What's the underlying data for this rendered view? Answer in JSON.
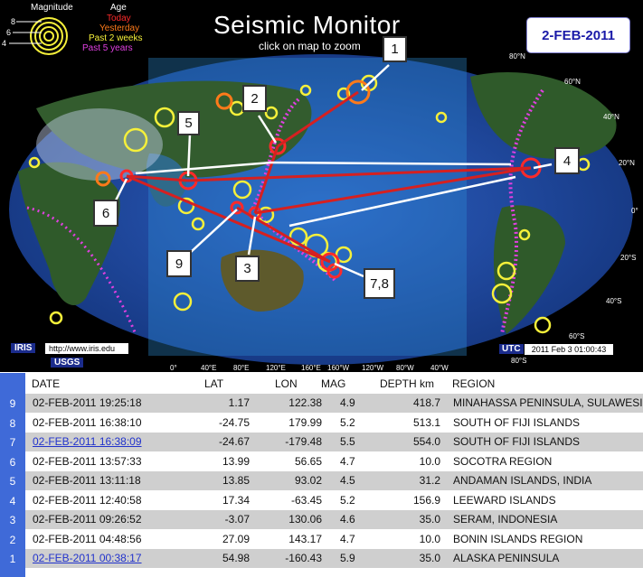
{
  "legend": {
    "magnitude_label": "Magnitude",
    "age_label": "Age",
    "mag_ticks": [
      "8",
      "6",
      "4"
    ],
    "age_items": [
      {
        "label": "Today",
        "color": "#ff2a2a"
      },
      {
        "label": "Yesterday",
        "color": "#ff7a1a"
      },
      {
        "label": "Past 2 weeks",
        "color": "#f5f03a"
      },
      {
        "label": "Past 5 years",
        "color": "#e040e0"
      }
    ]
  },
  "title": "Seismic Monitor",
  "subtitle": "click on map to zoom",
  "date_box": "2-FEB-2011",
  "callouts": [
    "1",
    "2",
    "4",
    "5",
    "6",
    "9",
    "3",
    "7,8"
  ],
  "lat_labels": [
    "80°N",
    "60°N",
    "40°N",
    "20°N",
    "0°",
    "20°S",
    "40°S",
    "60°S",
    "80°S"
  ],
  "lon_labels": [
    "0°",
    "40°E",
    "80°E",
    "120°E",
    "160°E",
    "160°W",
    "120°W",
    "80°W",
    "40°W"
  ],
  "footer": {
    "iris": "IRIS",
    "iris_url": "http://www.iris.edu",
    "usgs": "USGS",
    "utc": "UTC",
    "utc_time": "2011 Feb  3 01:00:43"
  },
  "table": {
    "headers": [
      "DATE",
      "LAT",
      "LON",
      "MAG",
      "DEPTH km",
      "REGION"
    ],
    "rows": [
      {
        "n": "9",
        "date": "02-FEB-2011 19:25:18",
        "lat": "1.17",
        "lon": "122.38",
        "mag": "4.9",
        "depth": "418.7",
        "region": "MINAHASSA PENINSULA, SULAWESI",
        "link": false
      },
      {
        "n": "8",
        "date": "02-FEB-2011 16:38:10",
        "lat": "-24.75",
        "lon": "179.99",
        "mag": "5.2",
        "depth": "513.1",
        "region": "SOUTH OF FIJI ISLANDS",
        "link": false
      },
      {
        "n": "7",
        "date": "02-FEB-2011 16:38:09",
        "lat": "-24.67",
        "lon": "-179.48",
        "mag": "5.5",
        "depth": "554.0",
        "region": "SOUTH OF FIJI ISLANDS",
        "link": true
      },
      {
        "n": "6",
        "date": "02-FEB-2011 13:57:33",
        "lat": "13.99",
        "lon": "56.65",
        "mag": "4.7",
        "depth": "10.0",
        "region": "SOCOTRA REGION",
        "link": false
      },
      {
        "n": "5",
        "date": "02-FEB-2011 13:11:18",
        "lat": "13.85",
        "lon": "93.02",
        "mag": "4.5",
        "depth": "31.2",
        "region": "ANDAMAN ISLANDS, INDIA",
        "link": false
      },
      {
        "n": "4",
        "date": "02-FEB-2011 12:40:58",
        "lat": "17.34",
        "lon": "-63.45",
        "mag": "5.2",
        "depth": "156.9",
        "region": "LEEWARD ISLANDS",
        "link": false
      },
      {
        "n": "3",
        "date": "02-FEB-2011 09:26:52",
        "lat": "-3.07",
        "lon": "130.06",
        "mag": "4.6",
        "depth": "35.0",
        "region": "SERAM, INDONESIA",
        "link": false
      },
      {
        "n": "2",
        "date": "02-FEB-2011 04:48:56",
        "lat": "27.09",
        "lon": "143.17",
        "mag": "4.7",
        "depth": "10.0",
        "region": "BONIN ISLANDS REGION",
        "link": false
      },
      {
        "n": "1",
        "date": "02-FEB-2011 00:38:17",
        "lat": "54.98",
        "lon": "-160.43",
        "mag": "5.9",
        "depth": "35.0",
        "region": "ALASKA PENINSULA",
        "link": true
      }
    ]
  }
}
